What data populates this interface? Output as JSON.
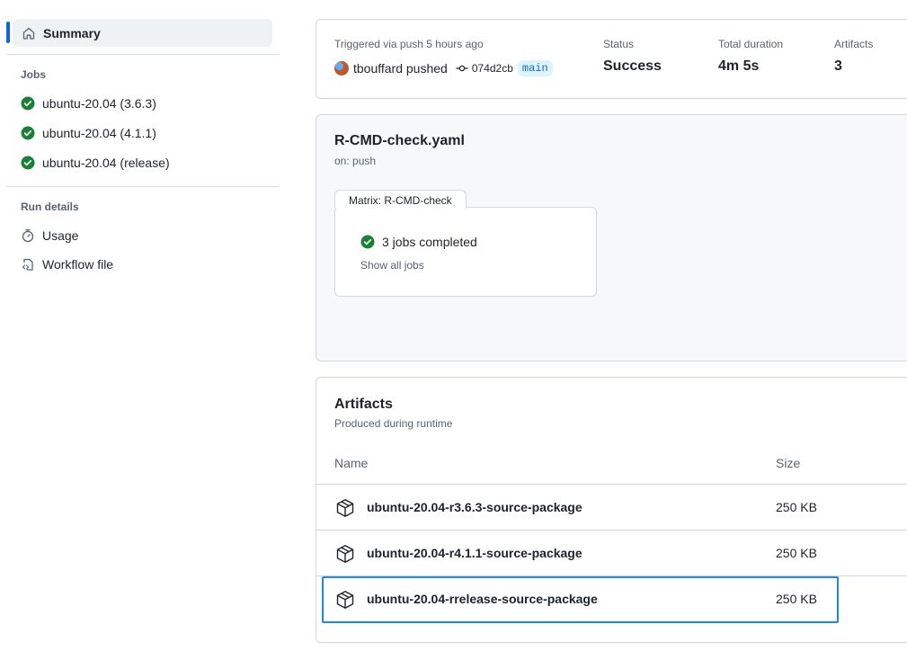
{
  "sidebar": {
    "summary_label": "Summary",
    "jobs_title": "Jobs",
    "jobs": [
      {
        "label": "ubuntu-20.04 (3.6.3)"
      },
      {
        "label": "ubuntu-20.04 (4.1.1)"
      },
      {
        "label": "ubuntu-20.04 (release)"
      }
    ],
    "run_details_title": "Run details",
    "usage_label": "Usage",
    "workflow_file_label": "Workflow file"
  },
  "run": {
    "trigger_text": "Triggered via push 5 hours ago",
    "user_action": "tbouffard pushed",
    "commit_sha": "074d2cb",
    "branch": "main",
    "status_label": "Status",
    "status_value": "Success",
    "duration_label": "Total duration",
    "duration_value": "4m 5s",
    "artifacts_label": "Artifacts",
    "artifacts_value": "3"
  },
  "workflow": {
    "file_name": "R-CMD-check.yaml",
    "trigger": "on: push",
    "matrix_tab": "Matrix: R-CMD-check",
    "jobs_completed": "3 jobs completed",
    "show_all_jobs": "Show all jobs"
  },
  "artifacts": {
    "title": "Artifacts",
    "subtitle": "Produced during runtime",
    "col_name": "Name",
    "col_size": "Size",
    "items": [
      {
        "name": "ubuntu-20.04-r3.6.3-source-package",
        "size": "250 KB"
      },
      {
        "name": "ubuntu-20.04-r4.1.1-source-package",
        "size": "250 KB"
      },
      {
        "name": "ubuntu-20.04-rrelease-source-package",
        "size": "250 KB"
      }
    ]
  },
  "colors": {
    "accent": "#0969da",
    "success": "#1a7f37",
    "highlight": "#1e88e5"
  }
}
